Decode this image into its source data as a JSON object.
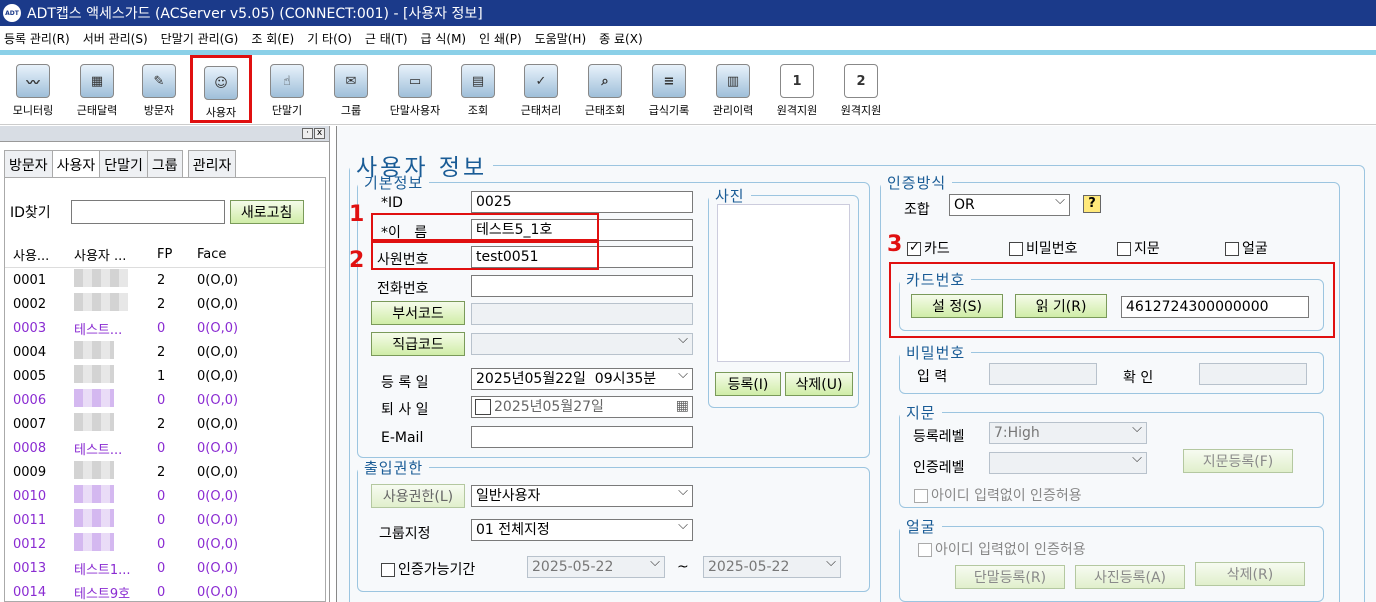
{
  "window": {
    "title": "ADT캡스 액세스가드 (ACServer v5.05) (CONNECT:001) - [사용자 정보]",
    "logo": "ADT"
  },
  "menu": [
    "등록 관리(R)",
    "서버 관리(S)",
    "단말기 관리(G)",
    "조 회(E)",
    "기 타(O)",
    "근 태(T)",
    "급 식(M)",
    "인 쇄(P)",
    "도움말(H)",
    "종 료(X)"
  ],
  "toolbar": [
    {
      "label": "모니터링",
      "icon": "monitor-icon"
    },
    {
      "label": "근태달력",
      "icon": "calendar-icon"
    },
    {
      "label": "방문자",
      "icon": "visitor-icon"
    },
    {
      "label": "사용자",
      "icon": "user-card-icon",
      "selected": true
    },
    {
      "label": "단말기",
      "icon": "terminal-icon"
    },
    {
      "label": "그룹",
      "icon": "group-icon"
    },
    {
      "label": "단말사용자",
      "icon": "terminal-user-icon"
    },
    {
      "label": "조회",
      "icon": "lookup-icon"
    },
    {
      "label": "근태처리",
      "icon": "attendance-icon"
    },
    {
      "label": "근태조회",
      "icon": "attendance-search-icon"
    },
    {
      "label": "급식기록",
      "icon": "meal-record-icon"
    },
    {
      "label": "관리이력",
      "icon": "history-icon"
    },
    {
      "label": "원격지원",
      "icon": "remote-1-icon",
      "digit": "1"
    },
    {
      "label": "원격지원",
      "icon": "remote-2-icon",
      "digit": "2"
    }
  ],
  "left": {
    "tabs": [
      "방문자",
      "사용자",
      "단말기",
      "그룹",
      "관리자"
    ],
    "active_tab": "사용자",
    "id_label": "ID찾기",
    "id_value": "",
    "refresh": "새로고침",
    "columns": [
      "사용...",
      "사용자 ...",
      "FP",
      "Face"
    ],
    "rows": [
      {
        "id": "0001",
        "name": "",
        "fp": "2",
        "face": "0(O,0)",
        "purple": false
      },
      {
        "id": "0002",
        "name": "",
        "fp": "2",
        "face": "0(O,0)",
        "purple": false
      },
      {
        "id": "0003",
        "name": "테스트...",
        "fp": "0",
        "face": "0(O,0)",
        "purple": true
      },
      {
        "id": "0004",
        "name": "",
        "fp": "2",
        "face": "0(O,0)",
        "purple": false
      },
      {
        "id": "0005",
        "name": "",
        "fp": "1",
        "face": "0(O,0)",
        "purple": false
      },
      {
        "id": "0006",
        "name": "",
        "fp": "0",
        "face": "0(O,0)",
        "purple": true
      },
      {
        "id": "0007",
        "name": "",
        "fp": "2",
        "face": "0(O,0)",
        "purple": false
      },
      {
        "id": "0008",
        "name": "테스트...",
        "fp": "0",
        "face": "0(O,0)",
        "purple": true
      },
      {
        "id": "0009",
        "name": "",
        "fp": "2",
        "face": "0(O,0)",
        "purple": false
      },
      {
        "id": "0010",
        "name": "",
        "fp": "0",
        "face": "0(O,0)",
        "purple": true
      },
      {
        "id": "0011",
        "name": "",
        "fp": "0",
        "face": "0(O,0)",
        "purple": true
      },
      {
        "id": "0012",
        "name": "",
        "fp": "0",
        "face": "0(O,0)",
        "purple": true
      },
      {
        "id": "0013",
        "name": "테스트1...",
        "fp": "0",
        "face": "0(O,0)",
        "purple": true
      },
      {
        "id": "0014",
        "name": "테스트9호",
        "fp": "0",
        "face": "0(O,0)",
        "purple": true
      }
    ]
  },
  "main": {
    "title": "사용자 정보",
    "basic": {
      "legend": "기본정보",
      "id_label": "*ID",
      "id_value": "0025",
      "name_label": "*이   름",
      "name_value": "테스트5_1호",
      "empno_label": "사원번호",
      "empno_value": "test0051",
      "phone_label": "전화번호",
      "phone_value": "",
      "dept_button": "부서코드",
      "dept_value": "",
      "rank_button": "직급코드",
      "rank_value": "",
      "reg_label": "등 록 일",
      "reg_value": "2025년05월22일  09시35분",
      "retire_label": "퇴 사 일",
      "retire_value": "2025년05월27일",
      "email_label": "E-Mail",
      "email_value": ""
    },
    "photo": {
      "legend": "사진",
      "register": "등록(I)",
      "delete": "삭제(U)"
    },
    "access": {
      "legend": "출입권한",
      "auth_button": "사용권한(L)",
      "auth_value": "일반사용자",
      "group_label": "그룹지정",
      "group_value": "01 전체지정",
      "period_label": "인증가능기간",
      "period_from": "2025-05-22",
      "period_tilde": "~",
      "period_to": "2025-05-22"
    },
    "auth": {
      "legend": "인증방식",
      "combo_label": "조합",
      "combo_value": "OR",
      "help": "?",
      "opt_card": "카드",
      "opt_pw": "비밀번호",
      "opt_fp": "지문",
      "opt_face": "얼굴",
      "card_legend": "카드번호",
      "card_set": "설 정(S)",
      "card_read": "읽 기(R)",
      "card_value": "4612724300000000",
      "pw_legend": "비밀번호",
      "pw_input": "입 력",
      "pw_confirm": "확 인",
      "fp_legend": "지문",
      "fp_reg_label": "등록레벨",
      "fp_reg_value": "7:High",
      "fp_auth_label": "인증레벨",
      "fp_auth_value": "",
      "fp_register": "지문등록(F)",
      "fp_noid": "아이디 입력없이 인증허용",
      "face_legend": "얼굴",
      "face_noid": "아이디 입력없이 인증허용",
      "face_term": "단말등록(R)",
      "face_photo": "사진등록(A)",
      "face_delete": "삭제(R)"
    },
    "annotations": [
      "1",
      "2",
      "3"
    ]
  }
}
